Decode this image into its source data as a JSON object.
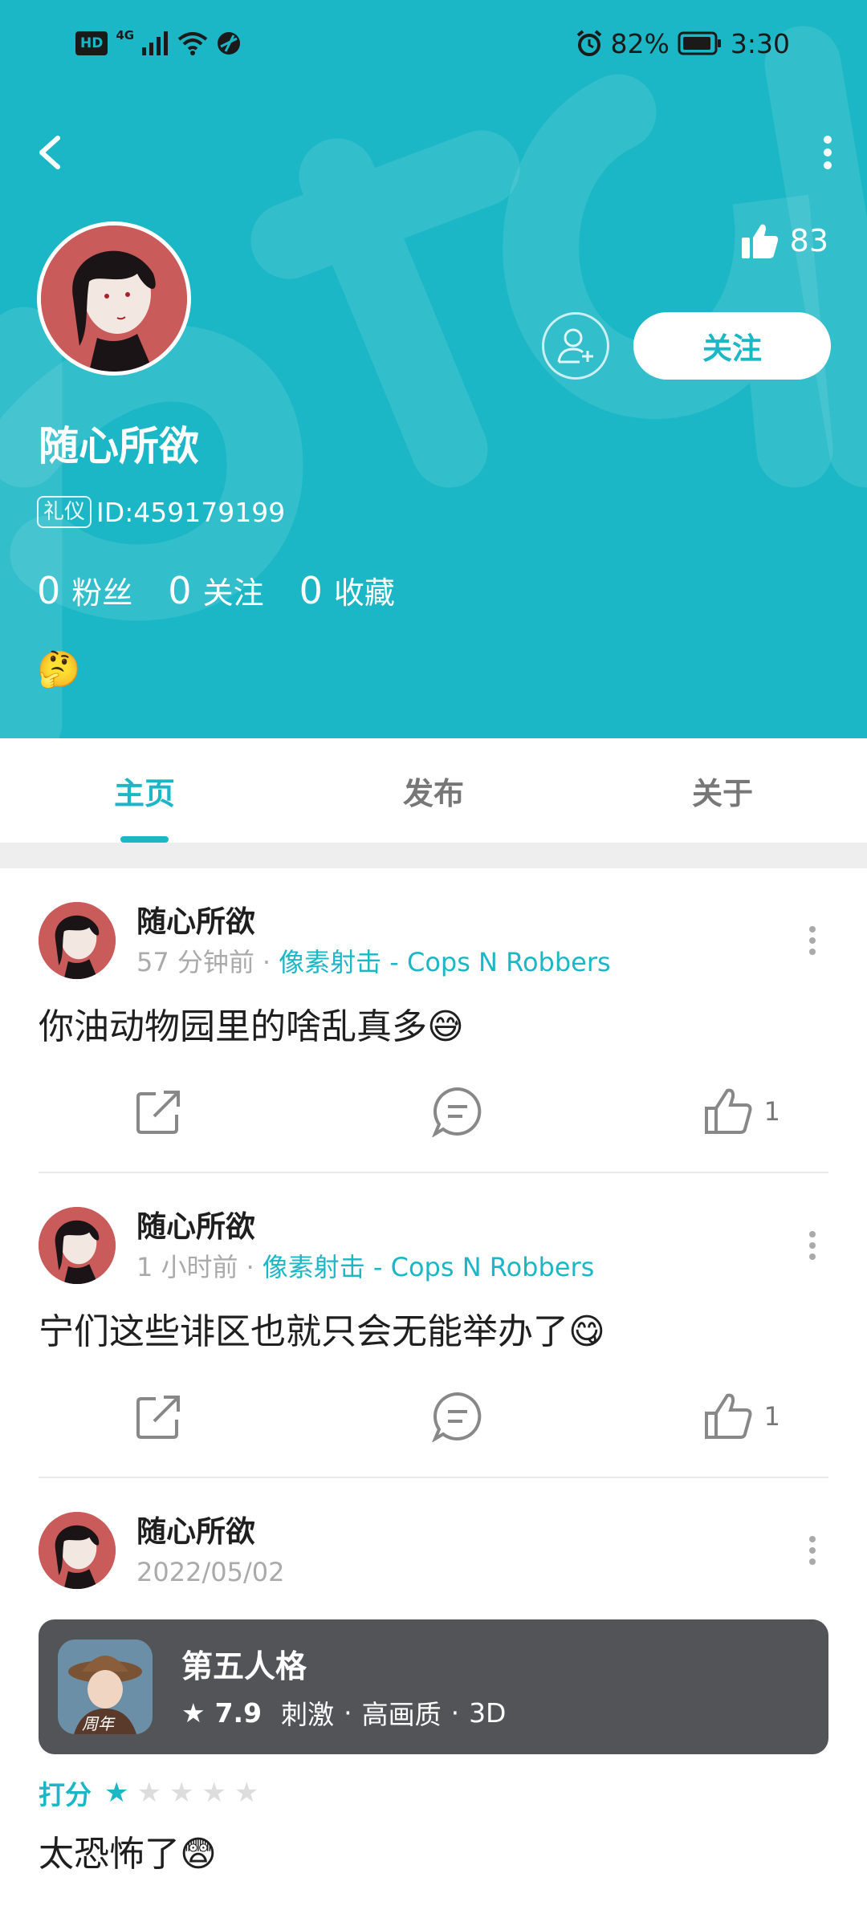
{
  "status": {
    "hd": "HD",
    "network": "4G",
    "battery": "82%",
    "time": "3:30"
  },
  "profile": {
    "likes": "83",
    "follow_label": "关注",
    "name": "随心所欲",
    "id_tag": "礼仪",
    "id_text": "ID:459179199",
    "stats": [
      {
        "num": "0",
        "label": "粉丝"
      },
      {
        "num": "0",
        "label": "关注"
      },
      {
        "num": "0",
        "label": "收藏"
      }
    ],
    "emoji": "🤔"
  },
  "tabs": [
    "主页",
    "发布",
    "关于"
  ],
  "posts": [
    {
      "author": "随心所欲",
      "time": "57 分钟前",
      "game": "像素射击 - Cops N Robbers",
      "text": "你油动物园里的啥乱真多😅",
      "likes": "1"
    },
    {
      "author": "随心所欲",
      "time": "1 小时前",
      "game": "像素射击 - Cops N Robbers",
      "text": "宁们这些诽区也就只会无能举办了😋",
      "likes": "1"
    },
    {
      "author": "随心所欲",
      "time": "2022/05/02",
      "game_card": {
        "name": "第五人格",
        "score": "7.9",
        "tags": [
          "刺激",
          "高画质",
          "3D"
        ],
        "icon_badge": "周年"
      },
      "rating_label": "打分",
      "rating": 1,
      "text": "太恐怖了😨"
    }
  ],
  "colors": {
    "accent": "#1bb7c6",
    "card": "#535458"
  }
}
